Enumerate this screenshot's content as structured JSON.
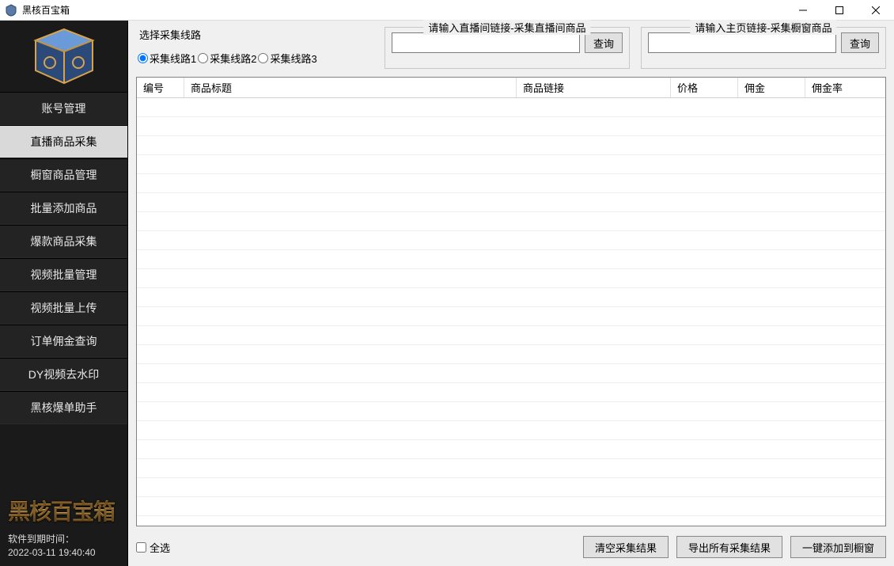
{
  "window": {
    "title": "黑核百宝箱"
  },
  "sidebar": {
    "items": [
      "账号管理",
      "直播商品采集",
      "橱窗商品管理",
      "批量添加商品",
      "爆款商品采集",
      "视频批量管理",
      "视频批量上传",
      "订单佣金查询",
      "DY视频去水印",
      "黑核爆单助手"
    ],
    "active_index": 1,
    "brand": "黑核百宝箱",
    "expiry_label": "软件到期时间：",
    "expiry_value": "2022-03-11 19:40:40"
  },
  "top": {
    "route_label": "选择采集线路",
    "routes": [
      "采集线路1",
      "采集线路2",
      "采集线路3"
    ],
    "route_selected": 0,
    "live_group_title": "请输入直播间链接-采集直播间商品",
    "live_input": "",
    "live_btn": "查询",
    "home_group_title": "请输入主页链接-采集橱窗商品",
    "home_input": "",
    "home_btn": "查询"
  },
  "table": {
    "columns": [
      "编号",
      "商品标题",
      "商品链接",
      "价格",
      "佣金",
      "佣金率"
    ],
    "rows": []
  },
  "bottom": {
    "select_all": "全选",
    "clear_btn": "清空采集结果",
    "export_btn": "导出所有采集结果",
    "add_btn": "一键添加到橱窗"
  }
}
